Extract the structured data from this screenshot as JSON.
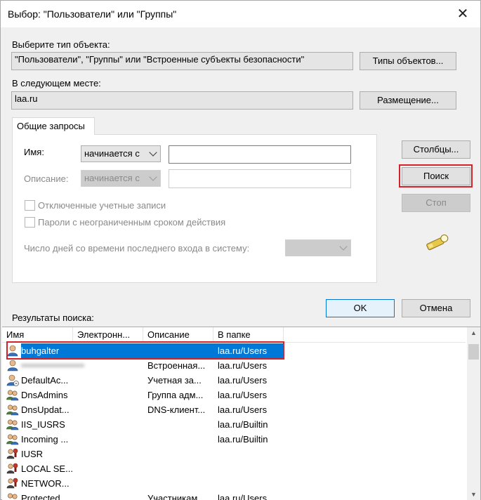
{
  "window": {
    "title": "Выбор: \"Пользователи\" или \"Группы\""
  },
  "object_type": {
    "label": "Выберите тип объекта:",
    "value": "\"Пользователи\", \"Группы\" или \"Встроенные субъекты безопасности\"",
    "button": "Типы объектов..."
  },
  "location": {
    "label": "В следующем месте:",
    "value": "laa.ru",
    "button": "Размещение..."
  },
  "tab": {
    "label": "Общие запросы"
  },
  "query": {
    "name_label": "Имя:",
    "name_mode": "начинается с",
    "name_value": "",
    "desc_label": "Описание:",
    "desc_mode": "начинается с",
    "desc_value": "",
    "disabled_accounts": "Отключенные учетные записи",
    "no_expire": "Пароли с неограниченным сроком действия",
    "days_label": "Число дней со времени последнего входа в систему:",
    "days_value": ""
  },
  "side_buttons": {
    "columns": "Столбцы...",
    "search": "Поиск",
    "stop": "Стоп"
  },
  "dialog_buttons": {
    "ok": "OK",
    "cancel": "Отмена"
  },
  "results": {
    "label": "Результаты поиска:",
    "columns": [
      "Имя",
      "Электронн...",
      "Описание",
      "В папке"
    ],
    "rows": [
      {
        "name": "buhgalter",
        "email": "",
        "description": "",
        "folder": "laa.ru/Users",
        "icon": "user-icon",
        "selected": true
      },
      {
        "name": "",
        "email": "",
        "description": "Встроенная...",
        "folder": "laa.ru/Users",
        "icon": "user-icon",
        "blurred": true
      },
      {
        "name": "DefaultAc...",
        "email": "",
        "description": "Учетная за...",
        "folder": "laa.ru/Users",
        "icon": "user-disabled-icon"
      },
      {
        "name": "DnsAdmins",
        "email": "",
        "description": "Группа адм...",
        "folder": "laa.ru/Users",
        "icon": "group-icon"
      },
      {
        "name": "DnsUpdat...",
        "email": "",
        "description": "DNS-клиент...",
        "folder": "laa.ru/Users",
        "icon": "group-icon"
      },
      {
        "name": "IIS_IUSRS",
        "email": "",
        "description": "",
        "folder": "laa.ru/Builtin",
        "icon": "group-icon"
      },
      {
        "name": "Incoming ...",
        "email": "",
        "description": "",
        "folder": "laa.ru/Builtin",
        "icon": "group-icon"
      },
      {
        "name": "IUSR",
        "email": "",
        "description": "",
        "folder": "",
        "icon": "principal-icon"
      },
      {
        "name": "LOCAL SE...",
        "email": "",
        "description": "",
        "folder": "",
        "icon": "principal-icon"
      },
      {
        "name": "NETWOR...",
        "email": "",
        "description": "",
        "folder": "",
        "icon": "principal-icon"
      },
      {
        "name": "Protected ...",
        "email": "",
        "description": "Участникам...",
        "folder": "laa.ru/Users",
        "icon": "group-icon"
      }
    ]
  },
  "colors": {
    "accent": "#0078d7",
    "highlight": "#d3222a"
  }
}
